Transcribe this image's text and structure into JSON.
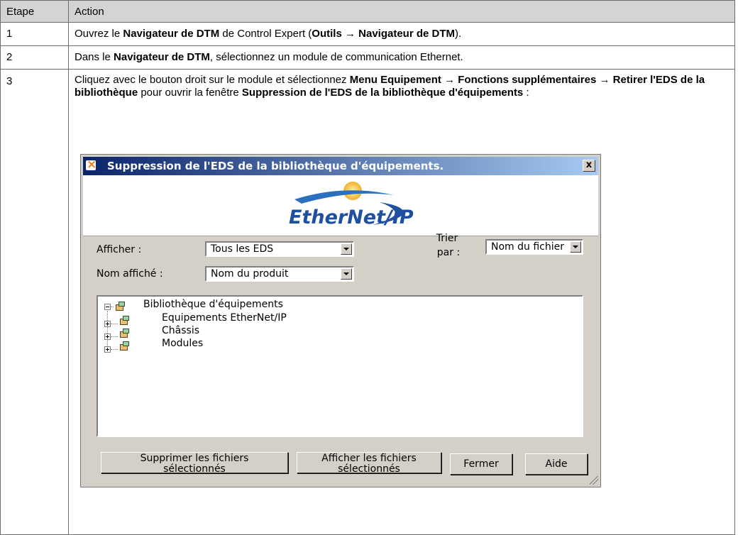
{
  "table": {
    "headers": {
      "step": "Etape",
      "action": "Action"
    },
    "rows": [
      {
        "step": "1",
        "parts": [
          "Ouvrez le ",
          "Navigateur de DTM",
          " de Control Expert (",
          "Outils",
          " → ",
          "Navigateur de DTM",
          ")."
        ]
      },
      {
        "step": "2",
        "parts": [
          "Dans le ",
          "Navigateur de DTM",
          ", sélectionnez un module de communication Ethernet."
        ]
      },
      {
        "step": "3",
        "parts": [
          "Cliquez avec le bouton droit sur le module et sélectionnez ",
          "Menu Equipement",
          " → ",
          "Fonctions supplémentaires",
          " → ",
          "Retirer l'EDS de la bibliothèque",
          " pour ouvrir la fenêtre ",
          "Suppression de l'EDS de la bibliothèque d'équipements",
          " :"
        ]
      }
    ]
  },
  "dialog": {
    "title": "Suppression de l'EDS de la bibliothèque d'équipements.",
    "close_label": "x",
    "logo_text": "EtherNet/IP",
    "show_label": "Afficher :",
    "show_value": "Tous les EDS",
    "sort_label_line1": "Trier",
    "sort_label_line2": "par :",
    "sort_value": "Nom du fichier",
    "display_name_label": "Nom affiché :",
    "display_name_value": "Nom du produit",
    "tree": {
      "root": "Bibliothèque d'équipements",
      "children": [
        "Equipements EtherNet/IP",
        "Châssis",
        "Modules"
      ]
    },
    "buttons": {
      "delete_line1": "Supprimer les fichiers",
      "delete_line2": "sélectionnés",
      "view_line1": "Afficher les fichiers",
      "view_line2": "sélectionnés",
      "close": "Fermer",
      "help": "Aide"
    }
  },
  "colors": {
    "header_bg": "#d4d4d4",
    "dialog_bg": "#d4d0c8",
    "titlebar_start": "#0a246a",
    "logo_blue": "#1e4fa0"
  }
}
